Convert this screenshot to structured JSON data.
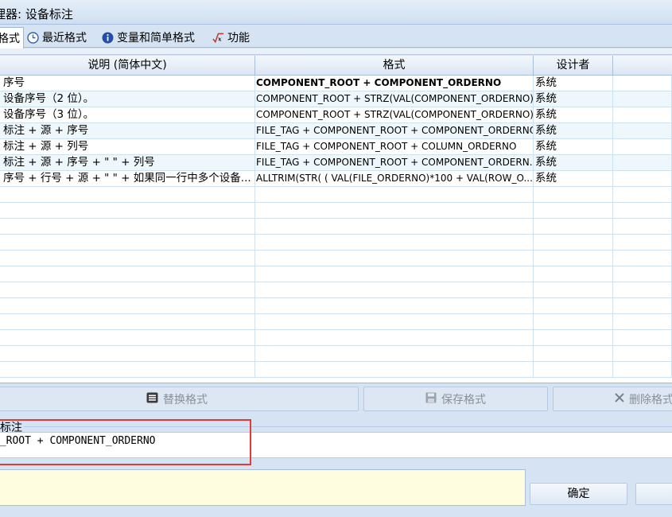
{
  "window": {
    "title": "理器: 设备标注"
  },
  "tabs": [
    {
      "label": "格式",
      "icon": "format-icon"
    },
    {
      "label": "最近格式",
      "icon": "clock-icon"
    },
    {
      "label": "变量和简单格式",
      "icon": "info-icon"
    },
    {
      "label": "功能",
      "icon": "function-icon"
    }
  ],
  "grid": {
    "columns": [
      "说明 (简体中文)",
      "格式",
      "设计者"
    ],
    "rows": [
      {
        "desc": "序号",
        "format": "COMPONENT_ROOT + COMPONENT_ORDERNO",
        "designer": "系统",
        "selected": true
      },
      {
        "desc": "设备序号（2 位）。",
        "format": "COMPONENT_ROOT + STRZ(VAL(COMPONENT_ORDERNO)...",
        "designer": "系统"
      },
      {
        "desc": "设备序号（3 位）。",
        "format": "COMPONENT_ROOT + STRZ(VAL(COMPONENT_ORDERNO)...",
        "designer": "系统"
      },
      {
        "desc": "标注 + 源 + 序号",
        "format": "FILE_TAG + COMPONENT_ROOT + COMPONENT_ORDERNO",
        "designer": "系统"
      },
      {
        "desc": "标注 + 源 + 列号",
        "format": "FILE_TAG + COMPONENT_ROOT + COLUMN_ORDERNO",
        "designer": "系统"
      },
      {
        "desc": "标注 + 源 + 序号 + \" \" + 列号",
        "format": "FILE_TAG + COMPONENT_ROOT + COMPONENT_ORDERN...",
        "designer": "系统"
      },
      {
        "desc": "序号 + 行号 + 源 + \" \" + 如果同一行中多个设备...",
        "format": "ALLTRIM(STR( ( VAL(FILE_ORDERNO)*100 + VAL(ROW_O...",
        "designer": "系统"
      }
    ]
  },
  "buttons": {
    "replace": "替换格式",
    "save": "保存格式",
    "delete": "删除格式"
  },
  "section": {
    "label": "标注"
  },
  "formula": {
    "value": "T_ROOT + COMPONENT_ORDERNO"
  },
  "footer": {
    "ok": "确定"
  }
}
